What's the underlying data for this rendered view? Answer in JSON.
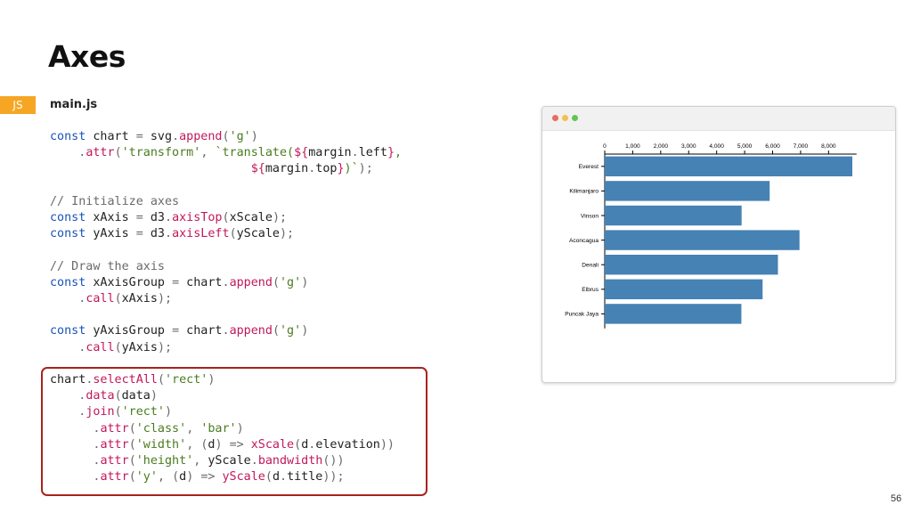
{
  "slide": {
    "title": "Axes",
    "page_number": "56"
  },
  "code_panel": {
    "language": "JS",
    "file_name": "main.js"
  },
  "browser_window": {
    "dot_colors": {
      "close": "#ec6a5e",
      "minimize": "#f4bf4f",
      "maximize": "#61c554"
    }
  },
  "accent_colors": {
    "badge": "#f6a623",
    "highlight_border": "#a8231e",
    "bar": "#4682b4"
  },
  "chart_data": {
    "type": "bar",
    "orientation": "horizontal",
    "categories": [
      "Everest",
      "Kilimanjaro",
      "Vinson",
      "Aconcagua",
      "Denali",
      "Elbrus",
      "Puncak Jaya"
    ],
    "values": [
      8849,
      5895,
      4892,
      6961,
      6190,
      5642,
      4884
    ],
    "x_ticks": [
      "0",
      "1,000",
      "2,000",
      "3,000",
      "4,000",
      "5,000",
      "6,000",
      "7,000",
      "8,000"
    ],
    "xlim": [
      0,
      9000
    ],
    "x_axis_position": "top",
    "grid": false,
    "color": "#4682b4"
  }
}
